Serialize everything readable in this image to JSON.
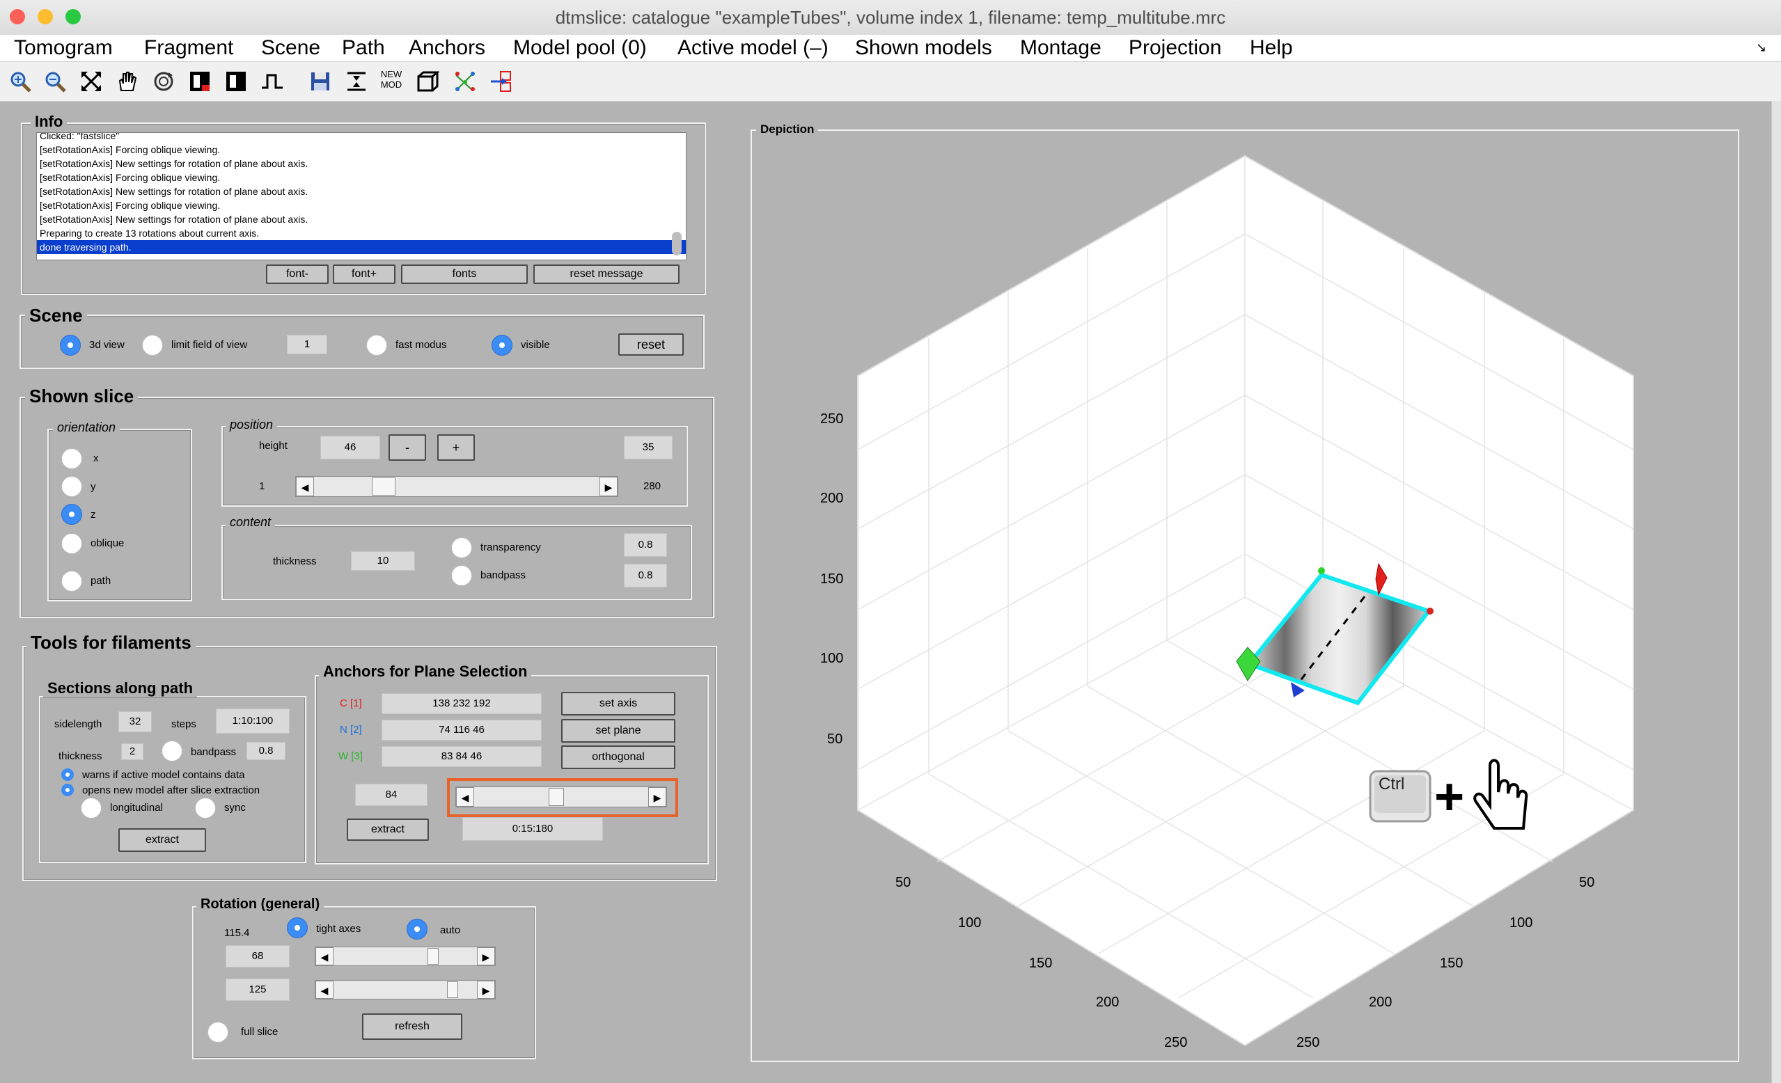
{
  "window": {
    "title": "dtmslice: catalogue \"exampleTubes\", volume index 1, filename: temp_multitube.mrc"
  },
  "menu": [
    "Tomogram",
    "Fragment",
    "Scene",
    "Path",
    "Anchors",
    "Model pool (0)",
    "Active model (–)",
    "Shown models",
    "Montage",
    "Projection",
    "Help"
  ],
  "toolbar": {
    "icons": [
      "zoom-in-icon",
      "zoom-out-icon",
      "fit-icon",
      "pan-hand-icon",
      "rotate-icon",
      "contrast-red-icon",
      "contrast-icon",
      "pulse-icon",
      "save-icon",
      "split-icon",
      "new-mod-icon",
      "cube-icon",
      "scatter-icon",
      "arrow-box-icon"
    ],
    "new_mod_label_1": "NEW",
    "new_mod_label_2": "MOD"
  },
  "info": {
    "title": "Info",
    "log": [
      "Clicked: \"fastslice\"",
      "[setRotationAxis] Forcing oblique viewing.",
      "[setRotationAxis] New settings for rotation of plane about axis.",
      "[setRotationAxis] Forcing oblique viewing.",
      "[setRotationAxis] New settings for rotation of plane about axis.",
      "[setRotationAxis] Forcing oblique viewing.",
      "[setRotationAxis] New settings for rotation of plane about axis.",
      "Preparing to create 13 rotations about current axis.",
      "done traversing path."
    ],
    "buttons": {
      "font_minus": "font-",
      "font_plus": "font+",
      "fonts": "fonts",
      "reset": "reset message"
    }
  },
  "scene": {
    "title": "Scene",
    "view3d": "3d view",
    "limit": "limit field of view",
    "limit_value": "1",
    "fast": "fast modus",
    "visible": "visible",
    "reset": "reset"
  },
  "slice": {
    "title": "Shown slice",
    "orientation": {
      "title": "orientation",
      "x": "x",
      "y": "y",
      "z": "z",
      "oblique": "oblique",
      "path": "path"
    },
    "position": {
      "title": "position",
      "height_label": "height",
      "height": "46",
      "minus": "-",
      "plus": "+",
      "current": "35",
      "min": "1",
      "max": "280",
      "level": 0.22
    },
    "content": {
      "title": "content",
      "thickness_label": "thickness",
      "thickness": "10",
      "transparency": "transparency",
      "transparency_value": "0.8",
      "bandpass": "bandpass",
      "bandpass_value": "0.8"
    }
  },
  "filaments": {
    "title": "Tools for filaments",
    "sections": {
      "title": "Sections along path",
      "sidelength_label": "sidelength",
      "sidelength": "32",
      "steps_label": "steps",
      "steps": "1:10:100",
      "thickness_label": "thickness",
      "thickness": "2",
      "bandpass_label": "bandpass",
      "bandpass": "0.8",
      "warns": "warns if active model contains data",
      "opens": "opens new model after slice extraction",
      "longitudinal": "longitudinal",
      "sync": "sync",
      "extract": "extract"
    },
    "anchors": {
      "title": "Anchors for Plane Selection",
      "c_label": "C [1]",
      "c_value": "138 232 192",
      "n_label": "N [2]",
      "n_value": "74 116 46",
      "w_label": "W [3]",
      "w_value": "83 84 46",
      "set_axis": "set axis",
      "set_plane": "set plane",
      "orthogonal": "orthogonal",
      "angle": "84",
      "range": "0:15:180",
      "extract": "extract",
      "level": 0.47,
      "c_color": "#e0201c",
      "n_color": "#1f6fd1",
      "w_color": "#28b428"
    }
  },
  "rotation": {
    "title": "Rotation (general)",
    "value_top": "115.4",
    "tight": "tight axes",
    "auto": "auto",
    "val1": "68",
    "val2": "125",
    "level1": 0.71,
    "level2": 0.86,
    "full_slice": "full slice",
    "refresh": "refresh"
  },
  "depiction": {
    "title": "Depiction",
    "z_ticks": [
      "250",
      "200",
      "150",
      "100",
      "50"
    ],
    "x_ticks": [
      "50",
      "100",
      "150",
      "200",
      "250"
    ],
    "y_ticks": [
      "50",
      "100",
      "150",
      "200",
      "250"
    ],
    "ctrl_key": "Ctrl",
    "plus": "+"
  },
  "colors": {
    "highlight": "#e8632c",
    "accent": "#3b8cf5",
    "tube_outline": "#12e8f0"
  }
}
